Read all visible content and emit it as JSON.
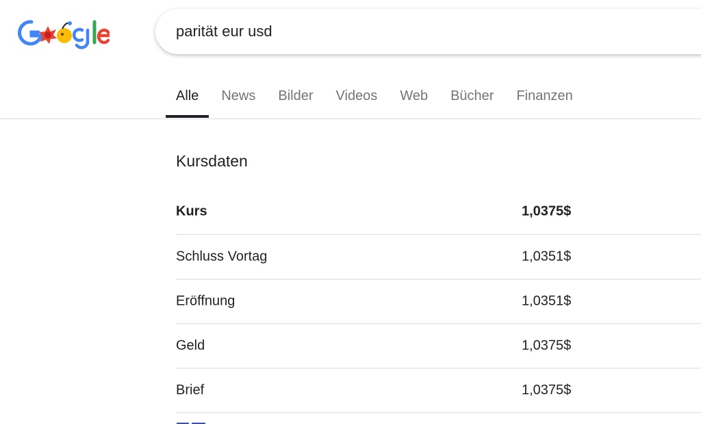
{
  "search": {
    "query": "parität eur usd"
  },
  "tabs": [
    {
      "label": "Alle",
      "active": true
    },
    {
      "label": "News",
      "active": false
    },
    {
      "label": "Bilder",
      "active": false
    },
    {
      "label": "Videos",
      "active": false
    },
    {
      "label": "Web",
      "active": false
    },
    {
      "label": "Bücher",
      "active": false
    },
    {
      "label": "Finanzen",
      "active": false
    }
  ],
  "kursdaten": {
    "title": "Kursdaten",
    "rows": [
      {
        "label": "Kurs",
        "value": "1,0375$"
      },
      {
        "label": "Schluss Vortag",
        "value": "1,0351$"
      },
      {
        "label": "Eröffnung",
        "value": "1,0351$"
      },
      {
        "label": "Geld",
        "value": "1,0375$"
      },
      {
        "label": "Brief",
        "value": "1,0375$"
      }
    ]
  },
  "colors": {
    "logo_blue": "#4285f4",
    "logo_red": "#ea4335",
    "logo_yellow": "#fbbc05",
    "logo_green": "#34a853",
    "text_primary": "#202124",
    "text_secondary": "#70757a",
    "divider": "#dadce0"
  }
}
